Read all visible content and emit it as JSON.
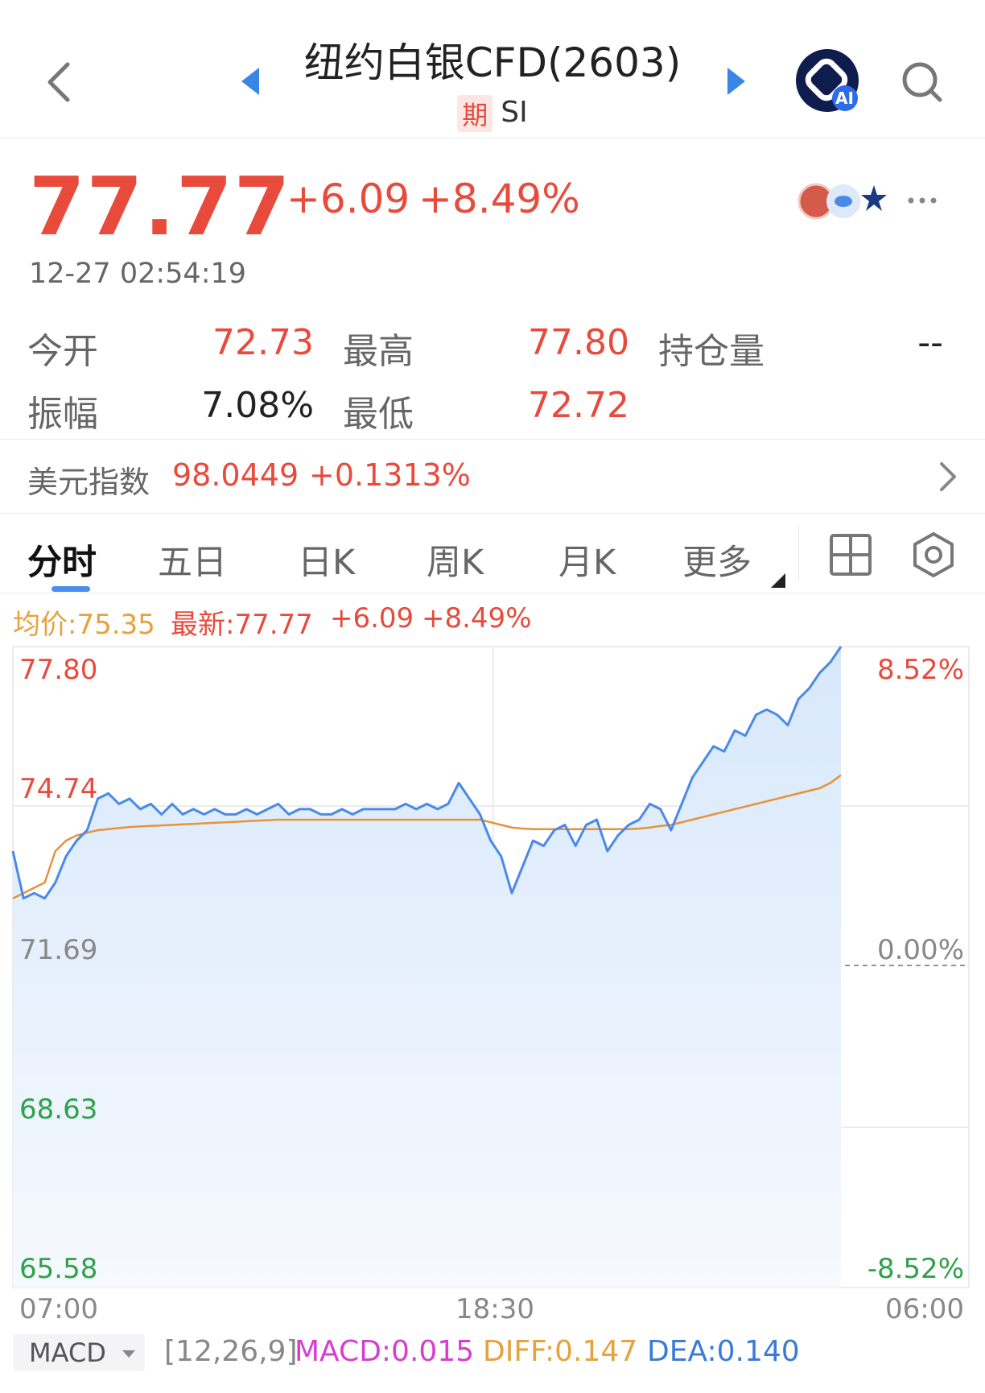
{
  "header": {
    "title": "纽约白银CFD(2603)",
    "badge": "期",
    "symbol": "SI",
    "ai_label": "AI"
  },
  "quote": {
    "price": "77.77",
    "change": "+6.09",
    "change_pct": "+8.49%",
    "timestamp": "12-27 02:54:19"
  },
  "stats": {
    "open_label": "今开",
    "open": "72.73",
    "high_label": "最高",
    "high": "77.80",
    "oi_label": "持仓量",
    "oi": "--",
    "amp_label": "振幅",
    "amp": "7.08%",
    "low_label": "最低",
    "low": "72.72"
  },
  "usd_index": {
    "label": "美元指数",
    "value": "98.0449",
    "change": "+0.1313%"
  },
  "tabs": [
    "分时",
    "五日",
    "日K",
    "周K",
    "月K",
    "更多"
  ],
  "legend": {
    "avg": "均价:75.35",
    "latest": "最新:77.77",
    "change": "+6.09",
    "pct": "+8.49%"
  },
  "axes": {
    "y_left": [
      "77.80",
      "74.74",
      "71.69",
      "68.63",
      "65.58"
    ],
    "y_right_top": "8.52%",
    "y_right_mid": "0.00%",
    "y_right_bottom": "-8.52%",
    "x": [
      "07:00",
      "18:30",
      "06:00"
    ]
  },
  "macd": {
    "selector": "MACD",
    "params": "[12,26,9]",
    "macd": "MACD:0.015",
    "diff": "DIFF:0.147",
    "dea": "DEA:0.140"
  },
  "chart_data": {
    "type": "line",
    "ylim": [
      65.58,
      77.8
    ],
    "prev_close": 71.69,
    "x_start": "07:00",
    "x_mid": "18:30",
    "x_end": "06:00",
    "series": [
      {
        "name": "最新",
        "color": "#4a8ae6",
        "values": [
          73.9,
          73.0,
          73.1,
          73.0,
          73.3,
          73.8,
          74.1,
          74.3,
          74.9,
          75.0,
          74.8,
          74.9,
          74.7,
          74.8,
          74.6,
          74.8,
          74.6,
          74.7,
          74.6,
          74.7,
          74.6,
          74.6,
          74.7,
          74.6,
          74.7,
          74.8,
          74.6,
          74.7,
          74.7,
          74.6,
          74.6,
          74.7,
          74.6,
          74.7,
          74.7,
          74.7,
          74.7,
          74.8,
          74.7,
          74.8,
          74.7,
          74.8,
          75.2,
          74.9,
          74.6,
          74.1,
          73.8,
          73.1,
          73.6,
          74.1,
          74.0,
          74.3,
          74.4,
          74.0,
          74.4,
          74.5,
          73.9,
          74.2,
          74.4,
          74.5,
          74.8,
          74.7,
          74.3,
          74.8,
          75.3,
          75.6,
          75.9,
          75.8,
          76.2,
          76.1,
          76.5,
          76.6,
          76.5,
          76.3,
          76.8,
          77.0,
          77.3,
          77.5,
          77.8
        ]
      },
      {
        "name": "均价",
        "color": "#e6933a",
        "values": [
          73.0,
          73.1,
          73.2,
          73.3,
          73.9,
          74.1,
          74.2,
          74.25,
          74.3,
          74.32,
          74.34,
          74.36,
          74.37,
          74.38,
          74.39,
          74.4,
          74.41,
          74.42,
          74.43,
          74.44,
          74.45,
          74.46,
          74.47,
          74.48,
          74.49,
          74.5,
          74.5,
          74.5,
          74.5,
          74.5,
          74.5,
          74.5,
          74.5,
          74.5,
          74.5,
          74.5,
          74.5,
          74.5,
          74.5,
          74.5,
          74.5,
          74.5,
          74.5,
          74.5,
          74.5,
          74.45,
          74.4,
          74.35,
          74.33,
          74.32,
          74.32,
          74.32,
          74.32,
          74.32,
          74.32,
          74.32,
          74.32,
          74.32,
          74.32,
          74.33,
          74.35,
          74.38,
          74.4,
          74.45,
          74.5,
          74.55,
          74.6,
          74.65,
          74.7,
          74.75,
          74.8,
          74.85,
          74.9,
          74.95,
          75.0,
          75.05,
          75.1,
          75.2,
          75.35
        ]
      }
    ]
  }
}
